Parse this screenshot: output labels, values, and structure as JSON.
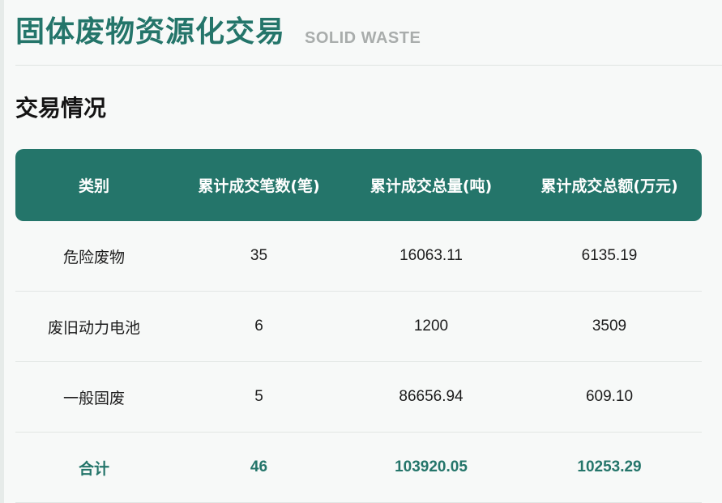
{
  "header": {
    "title": "固体废物资源化交易",
    "subtitle": "SOLID WASTE"
  },
  "section": {
    "title": "交易情况"
  },
  "table": {
    "columns": [
      "类别",
      "累计成交笔数(笔)",
      "累计成交总量(吨)",
      "累计成交总额(万元)"
    ],
    "rows": [
      {
        "category": "危险废物",
        "count": "35",
        "volume": "16063.11",
        "amount": "6135.19"
      },
      {
        "category": "废旧动力电池",
        "count": "6",
        "volume": "1200",
        "amount": "3509"
      },
      {
        "category": "一般固废",
        "count": "5",
        "volume": "86656.94",
        "amount": "609.10"
      }
    ],
    "total": {
      "category": "合计",
      "count": "46",
      "volume": "103920.05",
      "amount": "10253.29"
    }
  },
  "colors": {
    "accent": "#24756a",
    "header_text": "#ffffff",
    "subtitle": "#a9adac",
    "background": "#f7f9f8"
  }
}
